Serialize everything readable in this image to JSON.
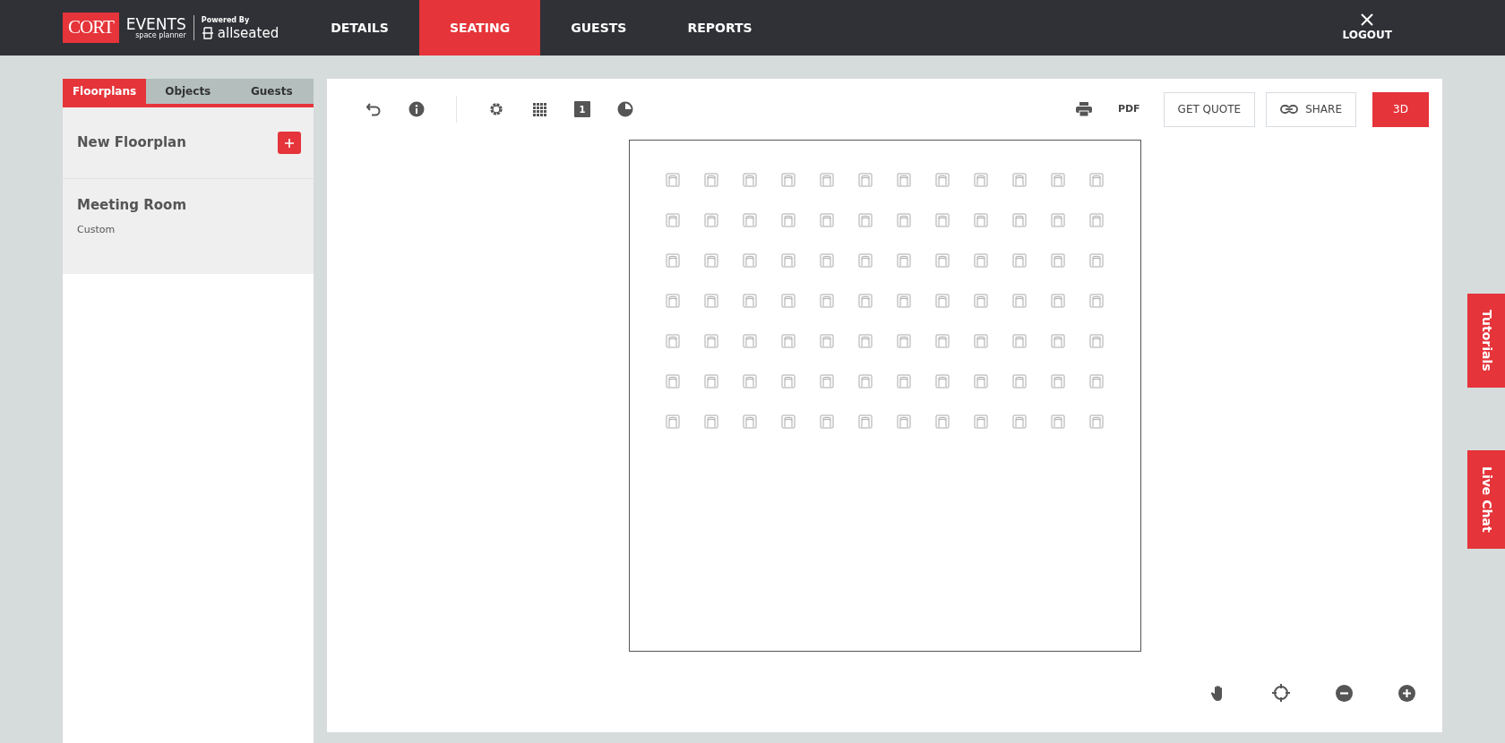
{
  "header": {
    "logo": {
      "brand": "CORT",
      "product": "EVENTS",
      "tagline": "space planner",
      "powered_by": "Powered By",
      "partner": "allseated"
    },
    "nav": [
      {
        "label": "DETAILS",
        "selected": false
      },
      {
        "label": "SEATING",
        "selected": true
      },
      {
        "label": "GUESTS",
        "selected": false
      },
      {
        "label": "REPORTS",
        "selected": false
      }
    ],
    "logout": "LOGOUT"
  },
  "sidebar": {
    "tabs": [
      {
        "label": "Floorplans",
        "selected": true
      },
      {
        "label": "Objects",
        "selected": false
      },
      {
        "label": "Guests",
        "selected": false
      }
    ],
    "floorplans": [
      {
        "kind": "new",
        "title": "New Floorplan"
      },
      {
        "kind": "item",
        "title": "Meeting Room",
        "subtitle": "Custom"
      }
    ]
  },
  "toolbar": {
    "page_number": "1",
    "pdf": "PDF",
    "get_quote": "GET QUOTE",
    "share": "SHARE",
    "view_3d": "3D"
  },
  "side_tabs": [
    "Tutorials",
    "Live Chat"
  ]
}
